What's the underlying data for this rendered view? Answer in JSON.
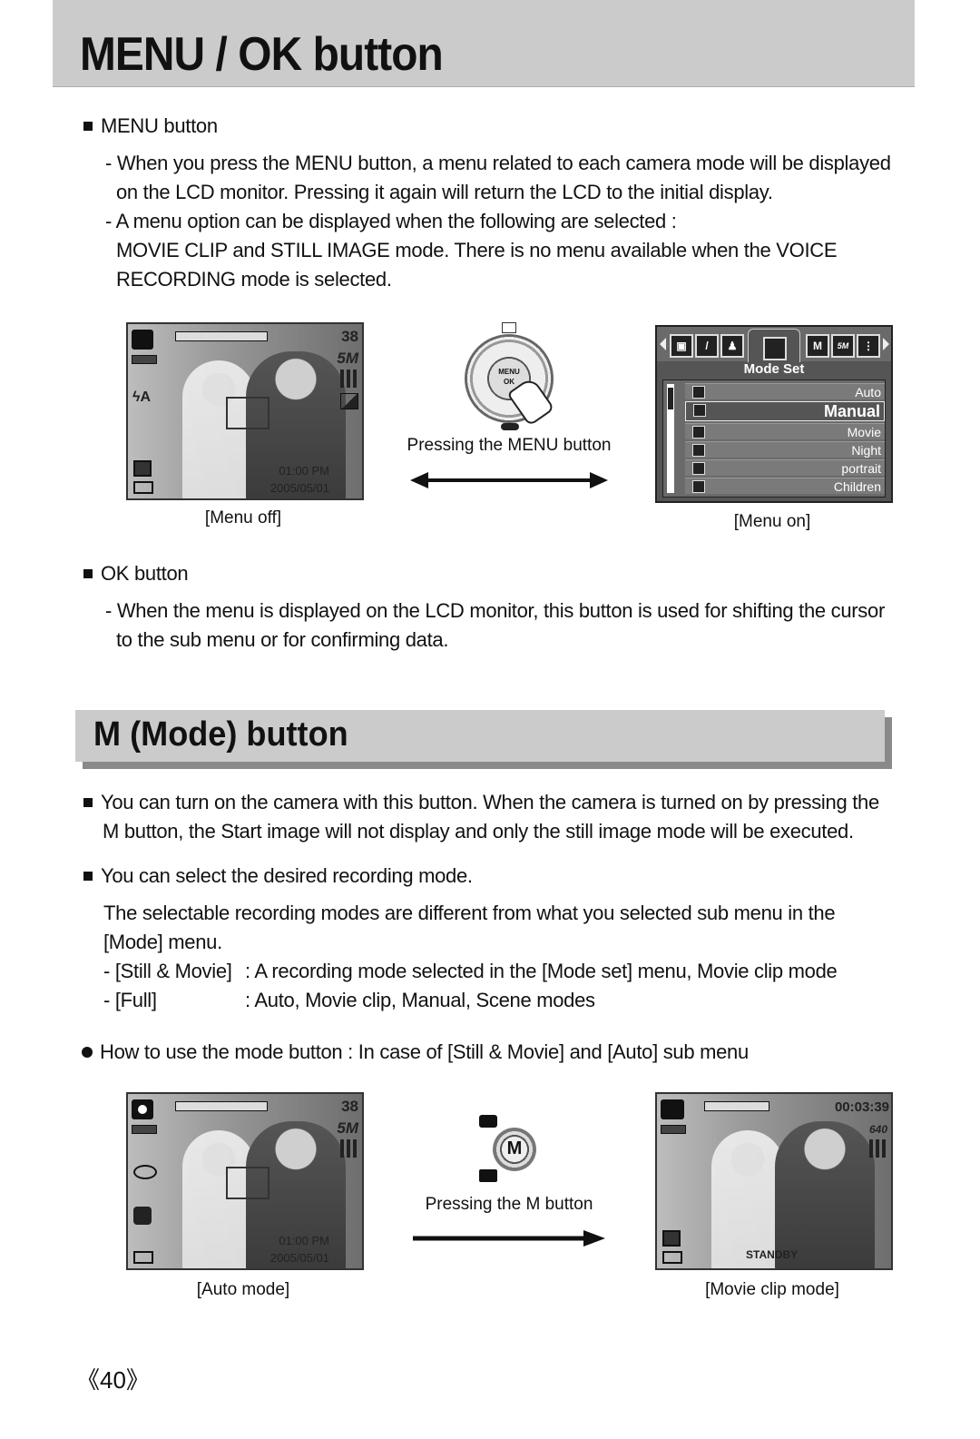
{
  "page_title": "MENU / OK button",
  "menu_section": {
    "heading": "MENU button",
    "lines": [
      "- When you press the MENU button, a menu related to each camera mode will be displayed",
      "on the LCD monitor. Pressing it again will return the LCD to the initial display.",
      "- A menu option can be displayed when the following are selected :",
      "MOVIE CLIP and STILL IMAGE mode. There is no menu available when the VOICE",
      "RECORDING mode is selected."
    ]
  },
  "figure1": {
    "left_lcd": {
      "caption": "[Menu off]",
      "shots": "38",
      "size": "5M",
      "flash": "ϟA",
      "time": "01:00 PM",
      "date": "2005/05/01"
    },
    "middle": {
      "dial_center": "MENU OK",
      "caption": "Pressing the MENU button"
    },
    "right_lcd": {
      "caption": "[Menu on]",
      "menu_title": "Mode Set",
      "tabs": [
        "M",
        "5M"
      ],
      "items": [
        {
          "label": "Auto",
          "selected": false
        },
        {
          "label": "Manual",
          "selected": true
        },
        {
          "label": "Movie",
          "selected": false
        },
        {
          "label": "Night",
          "selected": false
        },
        {
          "label": "portrait",
          "selected": false
        },
        {
          "label": "Children",
          "selected": false
        }
      ]
    }
  },
  "ok_section": {
    "heading": "OK button",
    "lines": [
      "- When the menu is displayed on the LCD monitor, this button is used for shifting the cursor",
      "to the sub menu or for confirming data."
    ]
  },
  "mode_section": {
    "title": "M (Mode) button",
    "para1": [
      "You can turn on the camera with this button. When the camera is turned on by pressing the",
      "M button, the Start image will not display and only the still image mode will be executed."
    ],
    "para2": "You can select the desired recording mode.",
    "para3": [
      "The selectable recording modes are different from what you selected sub menu in the",
      "[Mode] menu."
    ],
    "options": [
      {
        "key": "- [Still & Movie]",
        "value": ": A recording mode selected in the [Mode set] menu, Movie clip mode"
      },
      {
        "key": "- [Full]",
        "value": ": Auto, Movie clip, Manual, Scene modes"
      }
    ],
    "howto": "How to use the mode button : In case of [Still & Movie] and [Auto] sub menu"
  },
  "figure2": {
    "left_lcd": {
      "caption": "[Auto mode]",
      "shots": "38",
      "size": "5M",
      "time": "01:00 PM",
      "date": "2005/05/01"
    },
    "middle": {
      "button_label": "M",
      "caption": "Pressing the M button"
    },
    "right_lcd": {
      "caption": "[Movie clip mode]",
      "timer": "00:03:39",
      "size": "640",
      "status": "STANDBY"
    }
  },
  "page_number": "《40》"
}
